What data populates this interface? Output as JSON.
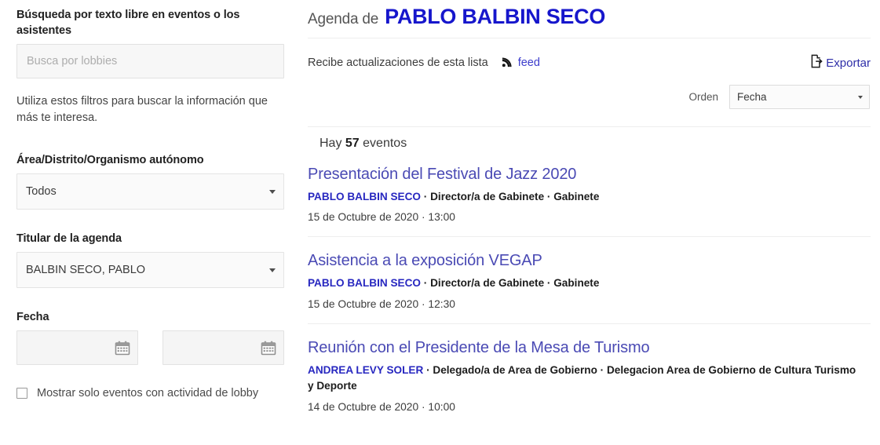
{
  "sidebar": {
    "search": {
      "label": "Búsqueda por texto libre en eventos o los asistentes",
      "placeholder": "Busca por lobbies",
      "value": ""
    },
    "helper": "Utiliza estos filtros para buscar la información que más te interesa.",
    "area": {
      "label": "Área/Distrito/Organismo autónomo",
      "value": "Todos"
    },
    "holder": {
      "label": "Titular de la agenda",
      "value": "BALBIN SECO, PABLO"
    },
    "date": {
      "label": "Fecha",
      "from_value": "",
      "to_value": "",
      "from_placeholder": "",
      "to_placeholder": ""
    },
    "lobby_checkbox": {
      "label": "Mostrar solo eventos con actividad de lobby",
      "checked": false
    }
  },
  "main": {
    "title_prefix": "Agenda de",
    "title_name": "PABLO BALBIN SECO",
    "feed_text": "Recibe actualizaciones de esta lista",
    "feed_link": "feed",
    "export_link": "Exportar",
    "orden_label": "Orden",
    "orden_value": "Fecha",
    "count_prefix": "Hay",
    "count_value": "57",
    "count_suffix": "eventos",
    "events": [
      {
        "title": "Presentación del Festival de Jazz 2020",
        "person": "PABLO BALBIN SECO",
        "role": "Director/a de Gabinete",
        "org": "Gabinete",
        "date": "15 de Octubre de 2020 · 13:00"
      },
      {
        "title": "Asistencia a la exposición VEGAP",
        "person": "PABLO BALBIN SECO",
        "role": "Director/a de Gabinete",
        "org": "Gabinete",
        "date": "15 de Octubre de 2020 · 12:30"
      },
      {
        "title": "Reunión con el Presidente de la Mesa de Turismo",
        "person": "ANDREA LEVY SOLER",
        "role": "Delegado/a de Area de Gobierno",
        "org": "Delegacion Area de Gobierno de Cultura Turismo y Deporte",
        "date": "14 de Octubre de 2020 · 10:00"
      }
    ]
  },
  "colors": {
    "title_blue": "#1616CC",
    "link_blue": "#4A4AB4",
    "person_blue": "#2828C0",
    "divider": "#EEEEEE"
  }
}
